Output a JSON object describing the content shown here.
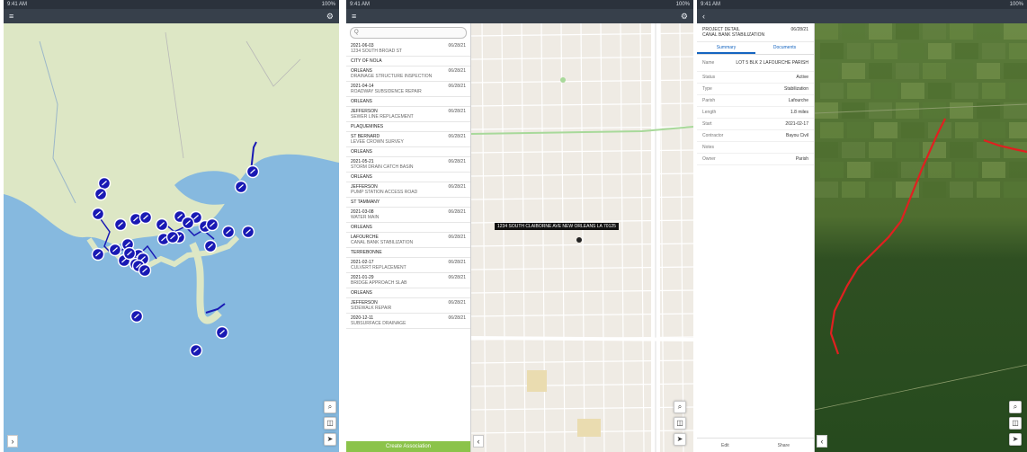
{
  "panels": {
    "overview": {
      "status_left": "9:41 AM",
      "status_right": "100%",
      "menu_glyph": "≡",
      "filter_glyph": "⚙",
      "expand_glyph": "›",
      "controls": [
        "⌕",
        "◫",
        "➤"
      ]
    },
    "list": {
      "status_left": "9:41 AM",
      "status_right": "100%",
      "menu_glyph": "≡",
      "filter_glyph": "⚙",
      "search_placeholder": "Q",
      "collapse_glyph": "‹",
      "controls": [
        "⌕",
        "◫",
        "➤"
      ],
      "footer_button": "Create Association",
      "tooltip": "1234 SOUTH CLAIBORNE AVE NEW ORLEANS LA 70125",
      "items": [
        {
          "title": "2021-06-03",
          "meta": "06/28/21",
          "sub": "1234 SOUTH BROAD ST"
        },
        {
          "title": "CITY OF NOLA",
          "meta": "",
          "sub": ""
        },
        {
          "title": "ORLEANS",
          "meta": "06/28/21",
          "sub": "DRAINAGE STRUCTURE INSPECTION"
        },
        {
          "title": "2021-04-14",
          "meta": "06/28/21",
          "sub": "ROADWAY SUBSIDENCE REPAIR"
        },
        {
          "title": "ORLEANS",
          "meta": "",
          "sub": ""
        },
        {
          "title": "JEFFERSON",
          "meta": "06/28/21",
          "sub": "SEWER LINE REPLACEMENT"
        },
        {
          "title": "PLAQUEMINES",
          "meta": "",
          "sub": ""
        },
        {
          "title": "ST BERNARD",
          "meta": "06/28/21",
          "sub": "LEVEE CROWN SURVEY"
        },
        {
          "title": "ORLEANS",
          "meta": "",
          "sub": ""
        },
        {
          "title": "2021-05-21",
          "meta": "06/28/21",
          "sub": "STORM DRAIN CATCH BASIN"
        },
        {
          "title": "ORLEANS",
          "meta": "",
          "sub": ""
        },
        {
          "title": "JEFFERSON",
          "meta": "06/28/21",
          "sub": "PUMP STATION ACCESS ROAD"
        },
        {
          "title": "ST TAMMANY",
          "meta": "",
          "sub": ""
        },
        {
          "title": "2021-03-08",
          "meta": "06/28/21",
          "sub": "WATER MAIN"
        },
        {
          "title": "ORLEANS",
          "meta": "",
          "sub": ""
        },
        {
          "title": "LAFOURCHE",
          "meta": "06/28/21",
          "sub": "CANAL BANK STABILIZATION"
        },
        {
          "title": "TERREBONNE",
          "meta": "",
          "sub": ""
        },
        {
          "title": "2021-02-17",
          "meta": "06/28/21",
          "sub": "CULVERT REPLACEMENT"
        },
        {
          "title": "2021-01-29",
          "meta": "06/28/21",
          "sub": "BRIDGE APPROACH SLAB"
        },
        {
          "title": "ORLEANS",
          "meta": "",
          "sub": ""
        },
        {
          "title": "JEFFERSON",
          "meta": "06/28/21",
          "sub": "SIDEWALK REPAIR"
        },
        {
          "title": "2020-12-11",
          "meta": "06/28/21",
          "sub": "SUBSURFACE DRAINAGE"
        }
      ]
    },
    "detail": {
      "status_left": "9:41 AM",
      "status_right": "100%",
      "back_glyph": "‹",
      "collapse_glyph": "‹",
      "controls": [
        "⌕",
        "◫",
        "➤"
      ],
      "head_title": "PROJECT DETAIL",
      "head_sub": "CANAL BANK STABILIZATION",
      "head_right": "06/28/21",
      "tabs": [
        "Summary",
        "Documents"
      ],
      "summary_value": "LOT 5 BLK 2 LAFOURCHE PARISH",
      "rows": [
        {
          "k": "Status",
          "v": "Active"
        },
        {
          "k": "Type",
          "v": "Stabilization"
        },
        {
          "k": "Parish",
          "v": "Lafourche"
        },
        {
          "k": "Length",
          "v": "1.8 miles"
        },
        {
          "k": "Start",
          "v": "2021-02-17"
        },
        {
          "k": "Contractor",
          "v": "Bayou Civil"
        },
        {
          "k": "Notes",
          "v": ""
        },
        {
          "k": "Owner",
          "v": "Parish"
        }
      ],
      "footer": [
        "Edit",
        "Share"
      ]
    }
  },
  "colors": {
    "marker": "#1919b4",
    "route": "#e02020",
    "water": "#86b9df",
    "land": "#dde7c5",
    "street_bg": "#efebe4",
    "accent": "#8bc34a"
  }
}
